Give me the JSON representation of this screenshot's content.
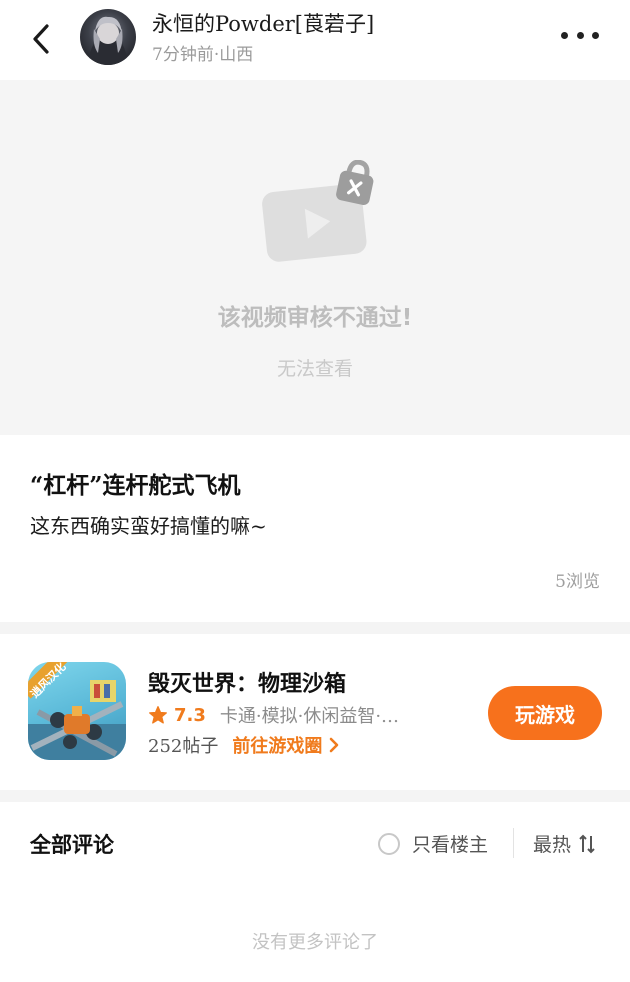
{
  "header": {
    "username": "永恒的Powder[莨菪子]",
    "meta": "7分钟前·山西"
  },
  "video": {
    "status_title": "该视频审核不通过!",
    "status_sub": "无法查看"
  },
  "post": {
    "title": "“杠杆”连杆舵式飞机",
    "body": "这东西确实蛮好搞懂的嘛~",
    "views": "5浏览"
  },
  "game": {
    "name": "毁灭世界：物理沙箱",
    "rating": "7.3",
    "tags": "卡通·模拟·休闲益智·…",
    "posts": "252帖子",
    "circle_link": "前往游戏圈",
    "play_label": "玩游戏",
    "badge_text": "逍风汉化"
  },
  "comments": {
    "title": "全部评论",
    "op_only_label": "只看楼主",
    "sort_label": "最热",
    "no_more": "没有更多评论了"
  },
  "colors": {
    "accent": "#f7711c",
    "rating": "#f07b1d",
    "muted": "#9b9b9b"
  },
  "icons": [
    "back-arrow-icon",
    "more-dots-icon",
    "video-locked-icon",
    "star-icon",
    "chevron-right-icon",
    "sort-arrows-icon"
  ]
}
